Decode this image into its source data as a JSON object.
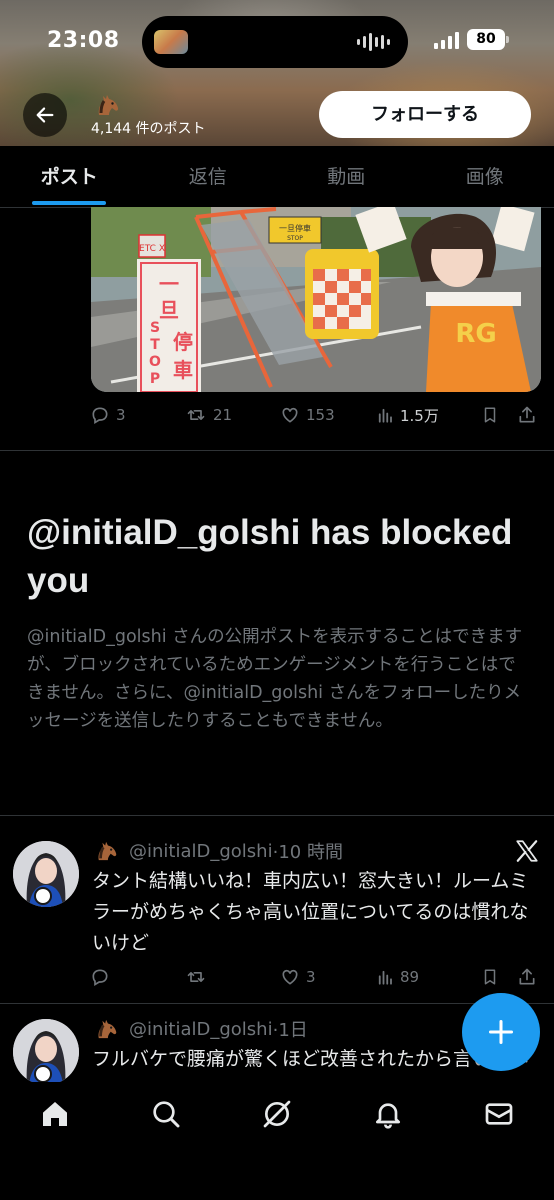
{
  "status_bar": {
    "time": "23:08",
    "battery": "80"
  },
  "profile_header": {
    "post_count": "4,144 件のポスト",
    "follow_label": "フォローする",
    "avatar_icon": "horse-emoji-icon"
  },
  "tabs": [
    {
      "label": "ポスト",
      "active": true
    },
    {
      "label": "返信",
      "active": false
    },
    {
      "label": "動画",
      "active": false
    },
    {
      "label": "画像",
      "active": false
    }
  ],
  "top_tweet": {
    "image_signs": {
      "etc": "ETC X",
      "stop_kanji": "一旦停車",
      "stop_en": "STOP",
      "small_sign": "一旦停車"
    },
    "stats": {
      "replies": "3",
      "reposts": "21",
      "likes": "153",
      "views": "1.5万"
    }
  },
  "blocked_notice": {
    "title": "@initialD_golshi has blocked you",
    "description": "@initialD_golshi さんの公開ポストを表示することはできますが、ブロックされているためエンゲージメントを行うことはできません。さらに、@initialD_golshi さんをフォローしたりメッセージを送信したりすることもできません。"
  },
  "tweets": [
    {
      "handle": "@initialD_golshi",
      "time": "·10 時間",
      "text": "タント結構いいね！車内広い！窓大きい！ルームミラーがめちゃくちゃ高い位置についてるのは慣れないけど",
      "stats": {
        "replies": "",
        "reposts": "",
        "likes": "3",
        "views": "89"
      }
    },
    {
      "handle": "@initialD_golshi",
      "time": "·1日",
      "text": "フルバケで腰痛が驚くほど改善されたから言いたい"
    }
  ],
  "colors": {
    "accent": "#1d9bf0",
    "background": "#000000",
    "text_primary": "#e7e9ea",
    "text_secondary": "#71767b"
  },
  "icons": {
    "back": "arrow-left-icon",
    "x_logo": "x-logo-icon",
    "compose": "plus-icon",
    "nav": [
      "home-icon",
      "search-icon",
      "grok-icon",
      "bell-icon",
      "mail-icon"
    ]
  }
}
